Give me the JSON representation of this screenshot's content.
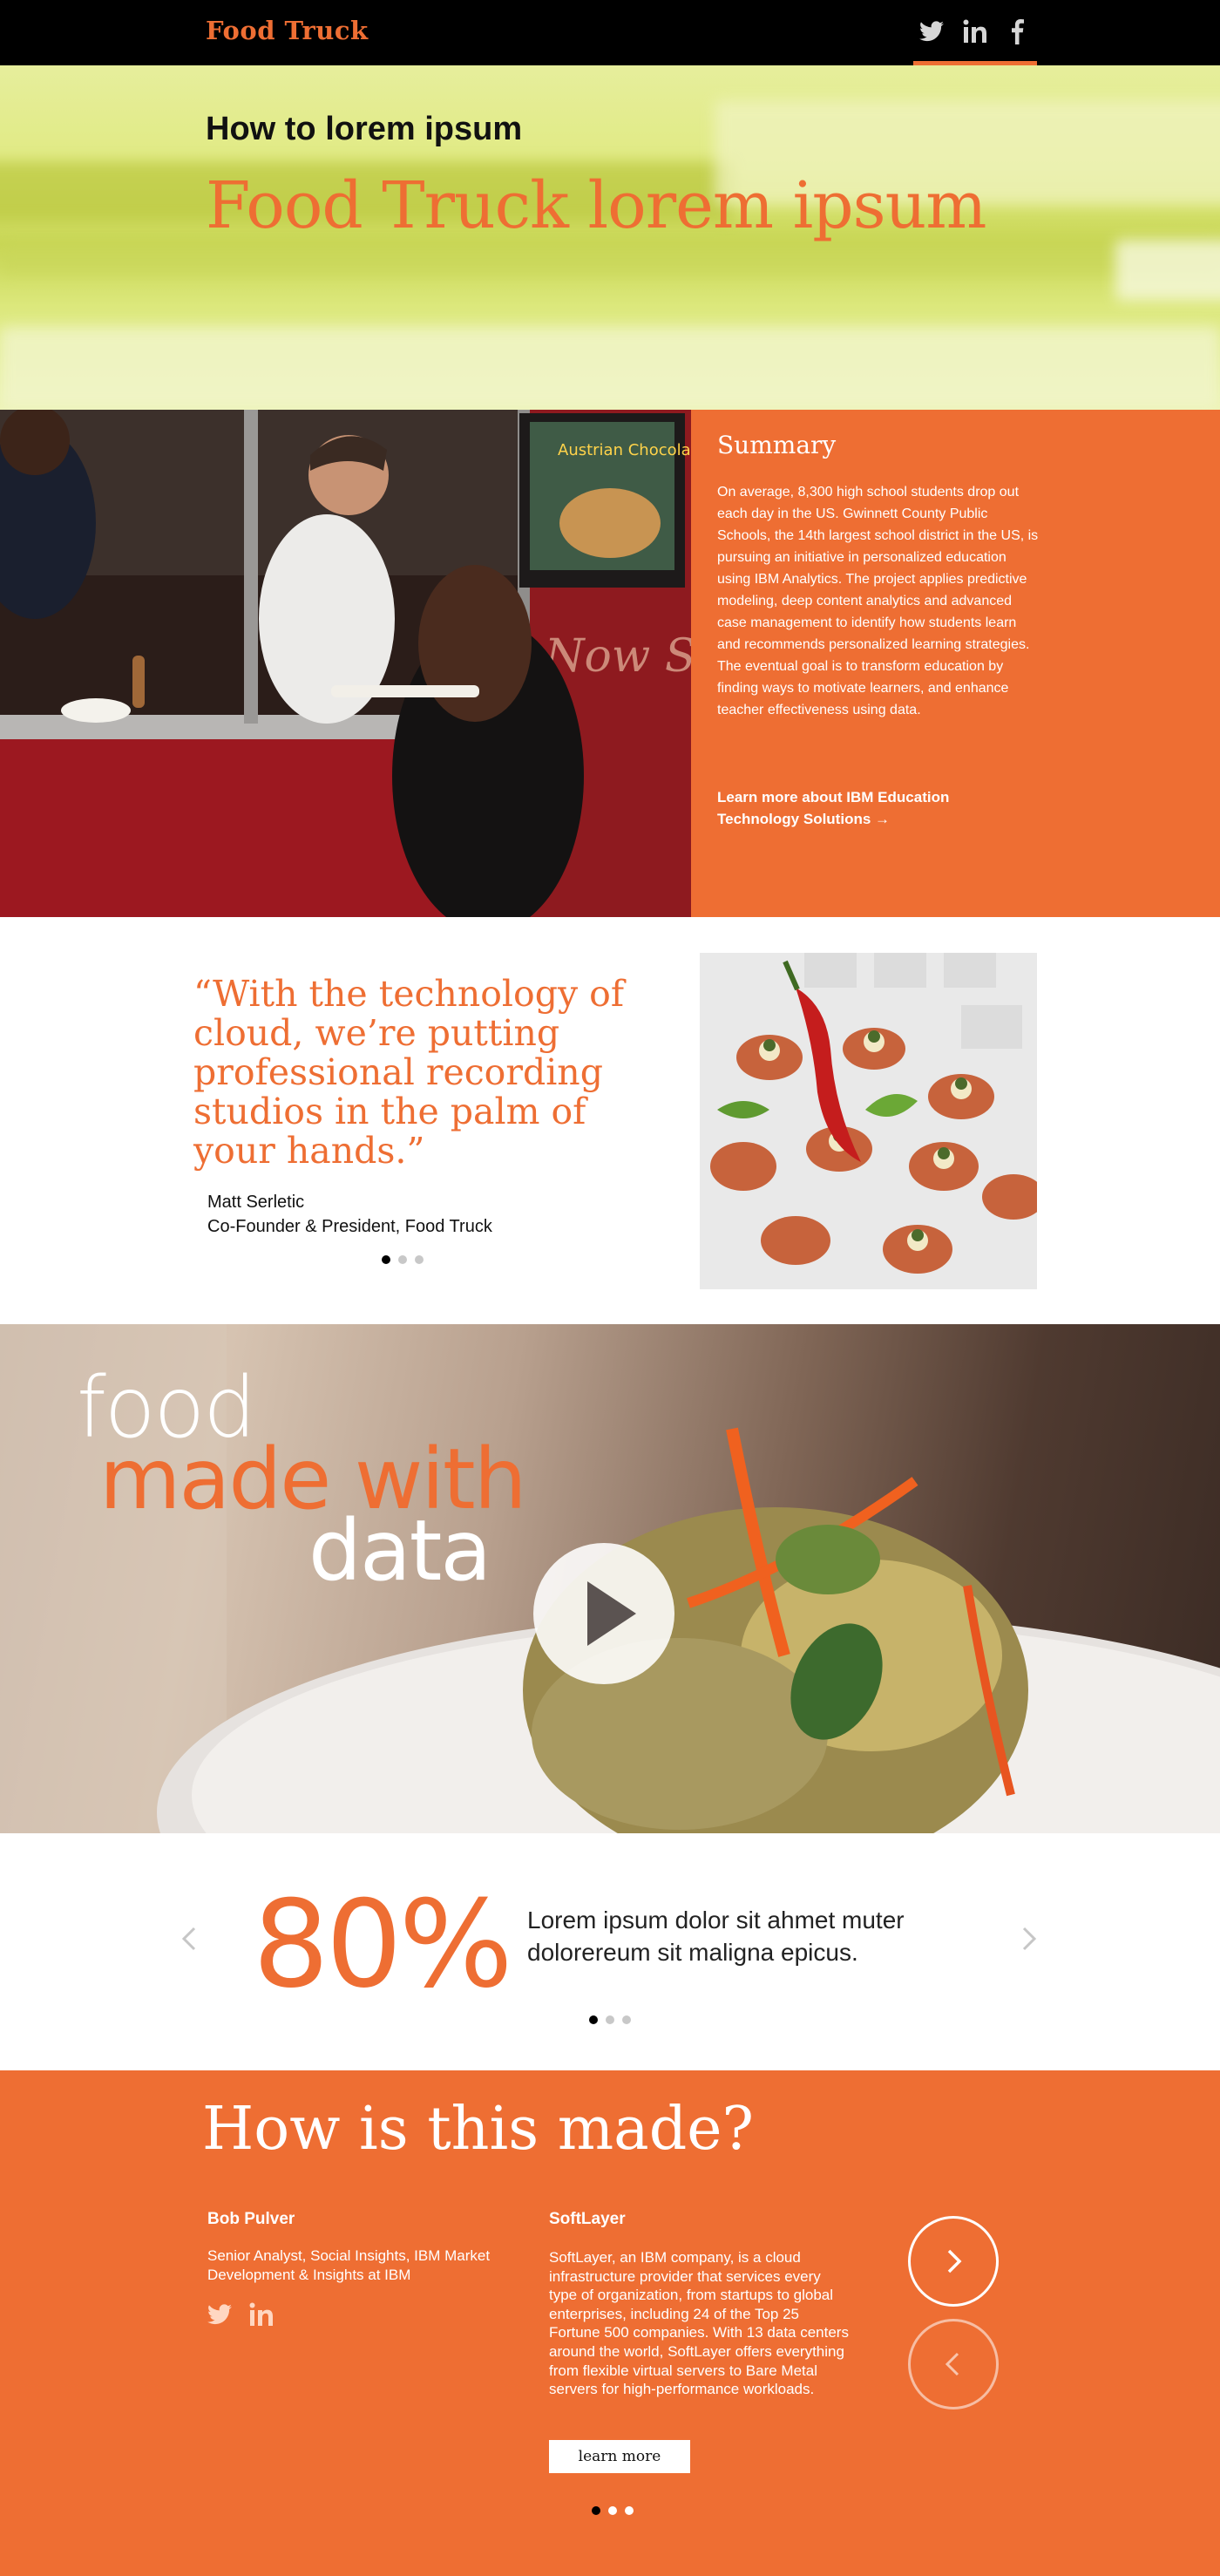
{
  "nav": {
    "brand": "Food Truck",
    "social": [
      "twitter-icon",
      "linkedin-icon",
      "facebook-icon"
    ]
  },
  "hero": {
    "subtitle": "How to lorem ipsum",
    "title": "Food Truck lorem ipsum"
  },
  "summary": {
    "heading": "Summary",
    "body": "On average, 8,300 high school students drop out each day in the US. Gwinnett County Public Schools, the 14th largest school district in the US, is pursuing an initiative in personalized education using IBM Analytics. The project applies predictive modeling, deep content analytics and advanced case management to identify how students learn and recommends personalized learning strategies. The eventual goal is to transform education by finding ways to motivate learners, and enhance teacher effectiveness using data.",
    "link": "Learn more about IBM Education Technology Solutions →",
    "photo_sign": "Austrian Chocolate Burrito",
    "photo_script": "Now Serving"
  },
  "testimonial": {
    "quote": "“With the technology of cloud, we’re putting professional recording studios in the palm of your hands.”",
    "name": "Matt Serletic",
    "role": "Co-Founder & President, Food Truck",
    "active_slide": 1,
    "slides": 3
  },
  "video": {
    "line1": "food",
    "line2": "made with",
    "line3": "data"
  },
  "stat": {
    "value": "80%",
    "text": "Lorem ipsum dolor sit ahmet muter dolorereum sit maligna epicus.",
    "active_slide": 1,
    "slides": 3
  },
  "footer": {
    "heading": "How is this made?",
    "person_name": "Bob Pulver",
    "person_role": "Senior Analyst, Social Insights, IBM Market Development & Insights at IBM",
    "company": "SoftLayer",
    "company_desc": "SoftLayer, an IBM company, is a cloud infrastructure provider that services every type of organization, from startups to global enterprises, including 24 of the Top 25 Fortune 500 companies. With 13 data centers around the world, SoftLayer offers everything from flexible virtual servers to Bare Metal servers for high-performance workloads.",
    "button": "learn more",
    "active_slide": 1,
    "slides": 3
  },
  "colors": {
    "accent": "#ee6e33",
    "nav_bg": "#000000"
  }
}
